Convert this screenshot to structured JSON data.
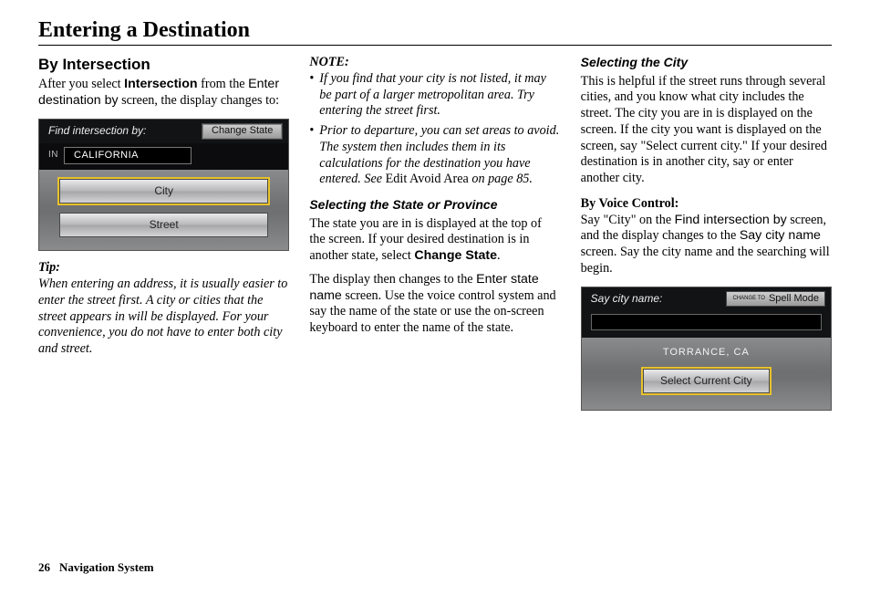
{
  "page": {
    "title": "Entering a Destination",
    "footer_page": "26",
    "footer_section": "Navigation System"
  },
  "col1": {
    "heading": "By Intersection",
    "p1_a": "After you select ",
    "p1_b": "Intersection",
    "p1_c": " from the ",
    "p1_d": "Enter destination by",
    "p1_e": " screen, the display changes to:",
    "tip_label": "Tip:",
    "tip_body": "When entering an address, it is usually easier to enter the street first. A city or cities that the street appears in will be displayed. For your convenience, you do not have to enter both city and street."
  },
  "shot1": {
    "title": "Find intersection by:",
    "change_state": "Change State",
    "in_label": "IN",
    "state_value": "CALIFORNIA",
    "btn_city": "City",
    "btn_street": "Street"
  },
  "col2": {
    "note_label": "NOTE:",
    "note1": "If you find that your city is not listed, it may be part of a larger metropolitan area. Try entering the street first.",
    "note2_a": "Prior to departure, you can set areas to avoid. The system then includes them in its calculations for the destination you have entered. See ",
    "note2_b": "Edit Avoid Area",
    "note2_c": " on page 85.",
    "h3_state": "Selecting the State or Province",
    "p_state_a": "The state you are in is displayed at the top of the screen. If your desired destination is in another state, select ",
    "p_state_b": "Change State",
    "p_state_c": ".",
    "p_state2_a": "The display then changes to the ",
    "p_state2_b": "Enter state name",
    "p_state2_c": " screen. Use the voice control system and say the name of the state or use the on-screen keyboard to enter the name of the state."
  },
  "col3": {
    "h3_city": "Selecting the City",
    "p_city": "This is helpful if the street runs through several cities, and you know what city includes the street. The city you are in is displayed on the screen. If the city you want is displayed on the screen, say \"Select current city.\" If your desired destination is in another city, say or enter another city.",
    "bvc_label": "By Voice Control:",
    "bvc_a": "Say \"City\" on the ",
    "bvc_b": "Find intersection by",
    "bvc_c": " screen, and the display changes to the ",
    "bvc_d": "Say city name",
    "bvc_e": " screen. Say the city name and the searching will begin."
  },
  "shot2": {
    "title": "Say city name:",
    "change_to": "CHANGE TO",
    "spell_mode": "Spell Mode",
    "city_value": "TORRANCE, CA",
    "select_current": "Select Current City"
  }
}
